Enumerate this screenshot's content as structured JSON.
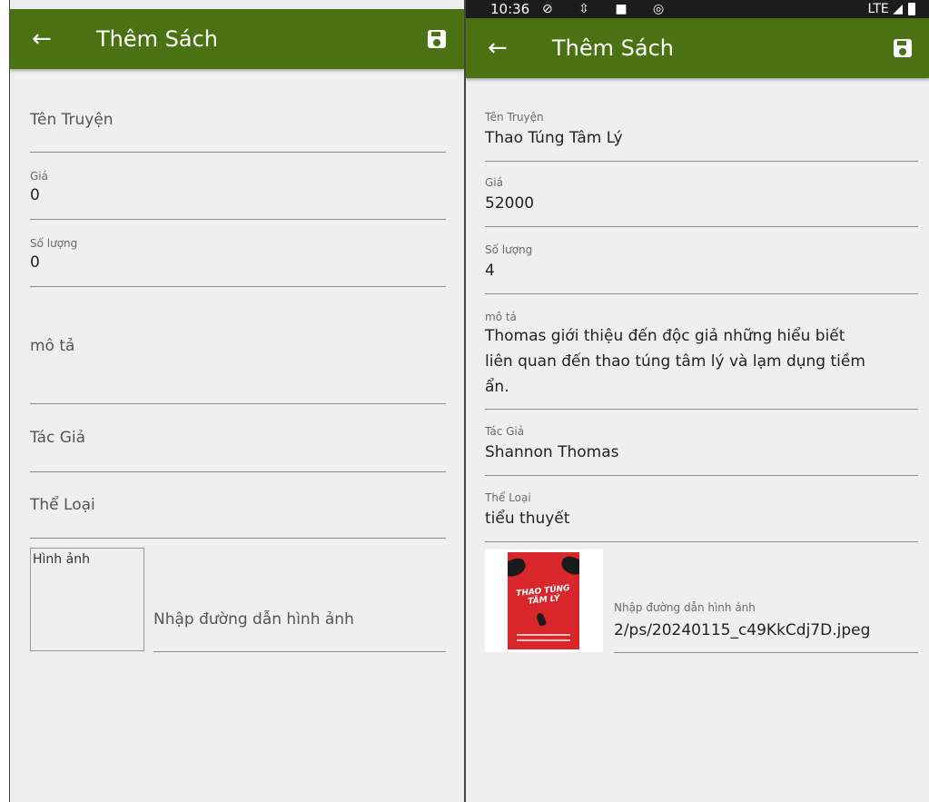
{
  "left_screen": {
    "appbar": {
      "title": "Thêm Sách",
      "back_icon": "←"
    },
    "fields": {
      "ten_truyen_hint": "Tên Truyện",
      "gia_label": "Giá",
      "gia_value": "0",
      "so_luong_label": "Số lượng",
      "so_luong_value": "0",
      "mo_ta_hint": "mô tả",
      "tac_gia_hint": "Tác Giả",
      "the_loai_hint": "Thể Loại",
      "hinh_anh_label": "Hình ảnh",
      "image_url_hint": "Nhập đường dẫn hình ảnh"
    }
  },
  "right_screen": {
    "statusbar": {
      "time": "10:36",
      "icons": "⊘ ⇳ ■ ◎",
      "network": "LTE ◢"
    },
    "appbar": {
      "title": "Thêm Sách",
      "back_icon": "←"
    },
    "fields": {
      "ten_truyen_label": "Tên Truyện",
      "ten_truyen_value": "Thao Túng Tâm Lý",
      "gia_label": "Giá",
      "gia_value": "52000",
      "so_luong_label": "Số lượng",
      "so_luong_value": "4",
      "mo_ta_label": "mô tả",
      "mo_ta_line1": "Thomas giới thiệu đến độc giả những hiểu biết",
      "mo_ta_line2": "liên quan đến thao túng tâm lý và lạm dụng tiềm",
      "mo_ta_line3": "ẩn.",
      "tac_gia_label": "Tác Giả",
      "tac_gia_value": "Shannon Thomas",
      "the_loai_label": "Thể Loại",
      "the_loai_value": "tiểu thuyết",
      "image_url_label": "Nhập đường dẫn hình ảnh",
      "image_url_value": "2/ps/20240115_c49KkCdj7D.jpeg"
    },
    "cover": {
      "title_text": "THAO TÚNG TÂM LÝ"
    }
  },
  "colors": {
    "appbar": "#4a7212",
    "background": "#efefef",
    "underline": "#8a8a8a"
  }
}
